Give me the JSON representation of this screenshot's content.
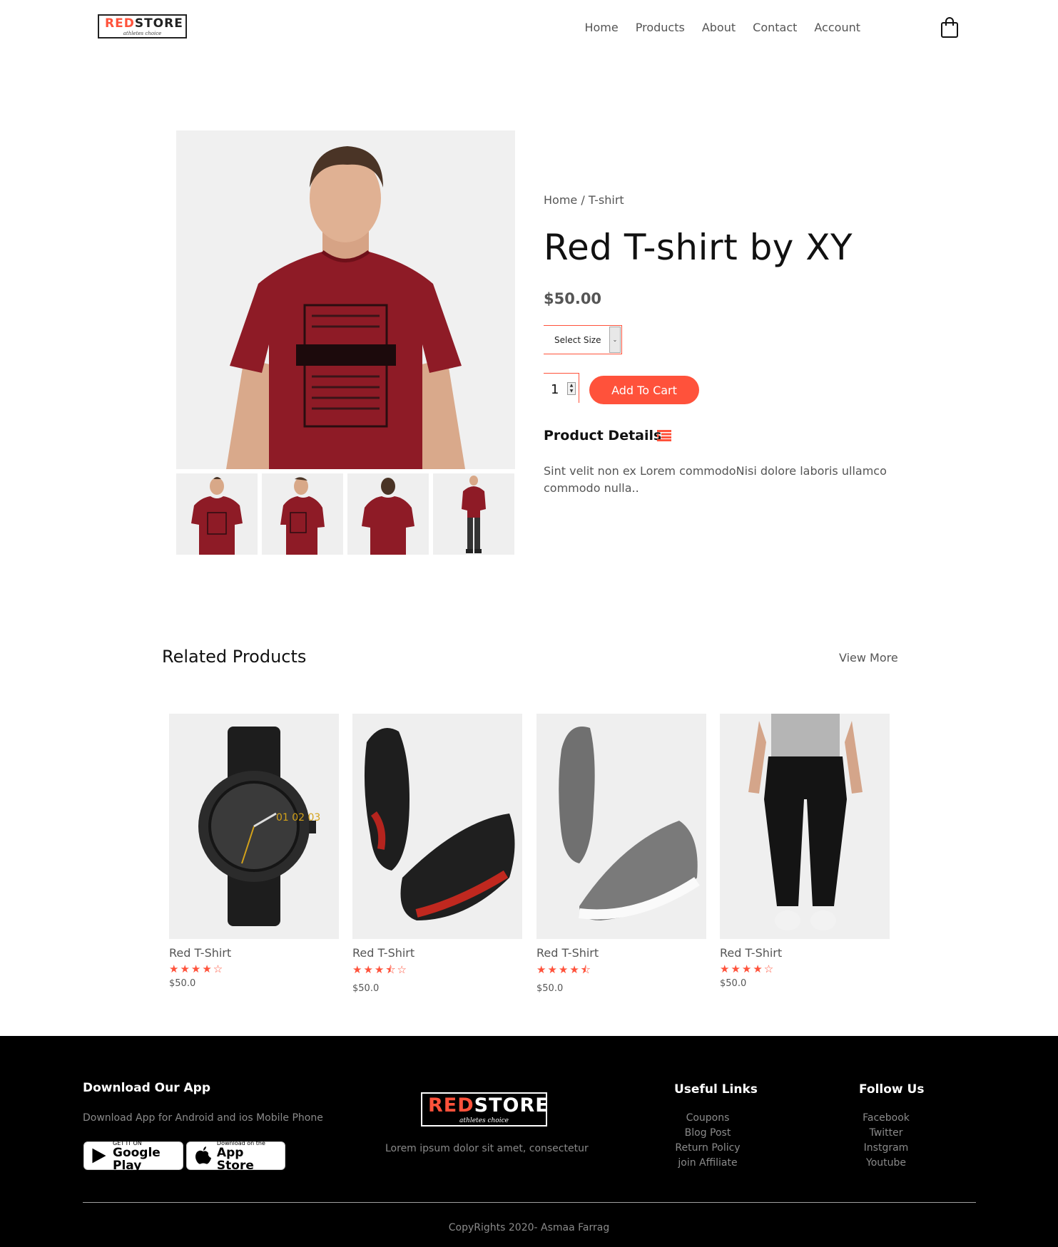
{
  "brand": {
    "red": "RED",
    "black": "STORE",
    "tagline": "athletes choice"
  },
  "nav": {
    "items": [
      "Home",
      "Products",
      "About",
      "Contact",
      "Account"
    ]
  },
  "product": {
    "breadcrumb": "Home / T-shirt",
    "title": "Red T-shirt by XY",
    "price": "$50.00",
    "size_select": "Select Size",
    "quantity": "1",
    "add_to_cart": "Add To Cart",
    "details_title": "Product Details",
    "description": "Sint velit non ex Lorem commodoNisi dolore laboris ullamco commodo nulla.."
  },
  "related": {
    "title": "Related Products",
    "view_more": "View More",
    "items": [
      {
        "name": "Red T-Shirt",
        "stars": "★★★★☆",
        "price": "$50.0",
        "image": "watch"
      },
      {
        "name": "Red T-Shirt",
        "stars": "★★★⯪☆",
        "price": "$50.0",
        "image": "black-sneakers"
      },
      {
        "name": "Red T-Shirt",
        "stars": "★★★★⯪",
        "price": "$50.0",
        "image": "grey-shoes"
      },
      {
        "name": "Red T-Shirt",
        "stars": "★★★★☆",
        "price": "$50.0",
        "image": "joggers"
      }
    ]
  },
  "footer": {
    "download_title": "Download Our App",
    "download_text": "Download App for Android and ios Mobile Phone",
    "google_small": "GET IT ON",
    "google_big": "Google Play",
    "apple_small": "Download on the",
    "apple_big": "App Store",
    "about_text": "Lorem ipsum dolor sit amet, consectetur",
    "useful_title": "Useful Links",
    "useful_links": [
      "Coupons",
      "Blog Post",
      "Return Policy",
      "join Affiliate"
    ],
    "follow_title": "Follow Us",
    "follow_links": [
      "Facebook",
      "Twitter",
      "Instgram",
      "Youtube"
    ],
    "copyright": "CopyRights 2020- Asmaa Farrag"
  },
  "colors": {
    "accent": "#ff523b",
    "footer_bg": "#000000",
    "text": "#555555"
  }
}
